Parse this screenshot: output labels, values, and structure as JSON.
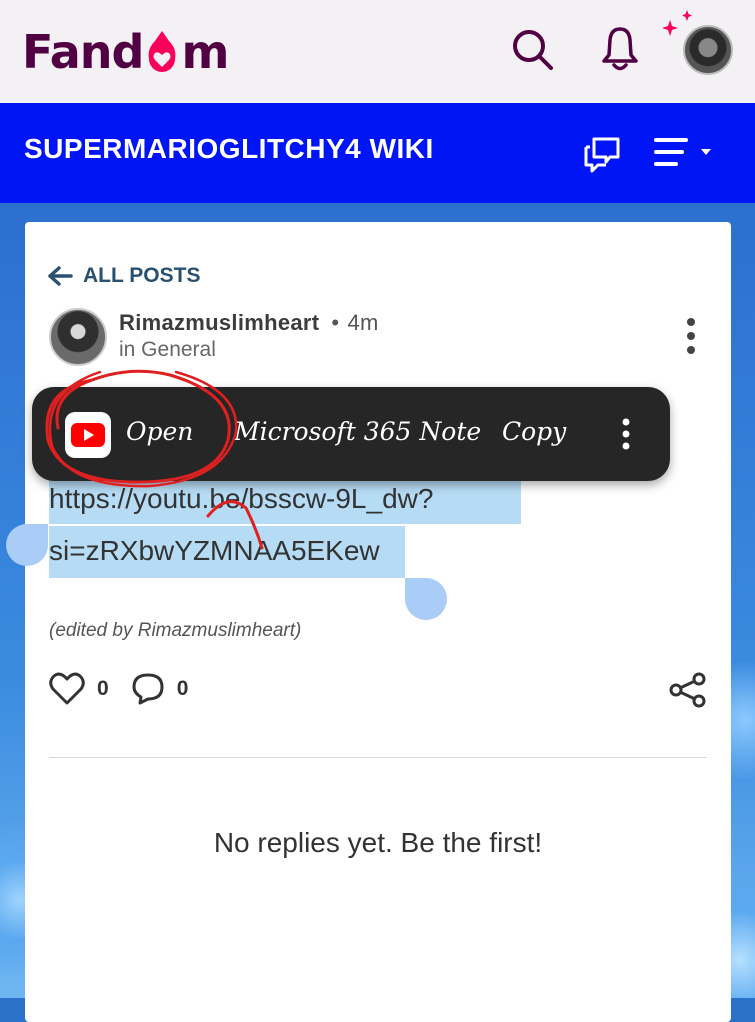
{
  "header": {
    "logo_text": "Fandom",
    "logo_prefix": "Fand",
    "logo_heart": "ʘ",
    "logo_suffix": "m",
    "icons": [
      "search-icon",
      "bell-icon",
      "avatar",
      "sparkle-icon"
    ]
  },
  "community": {
    "title": "SUPERMARIOGLITCHY4 WIKI",
    "icons": [
      "discussions-icon",
      "menu-icon"
    ]
  },
  "post": {
    "back_label": "ALL POSTS",
    "author": "Rimazmuslimheart",
    "separator": "•",
    "time": "4m",
    "category": "in General",
    "link_line1": "https://youtu.be/bsscw-9L_dw?",
    "link_line2": "si=zRXbwYZMNAA5EKew",
    "edited_note": "(edited by Rimazmuslimheart)",
    "likes": "0",
    "comments": "0",
    "no_replies": "No replies yet. Be the first!"
  },
  "context_menu": {
    "open": "Open",
    "note": "Microsoft 365 Note",
    "copy": "Copy"
  },
  "colors": {
    "brand": "#520044",
    "brand_accent": "#fa005a",
    "community_bar": "#0015f5",
    "selection": "#b6dcf5",
    "toolbar": "#262626"
  }
}
